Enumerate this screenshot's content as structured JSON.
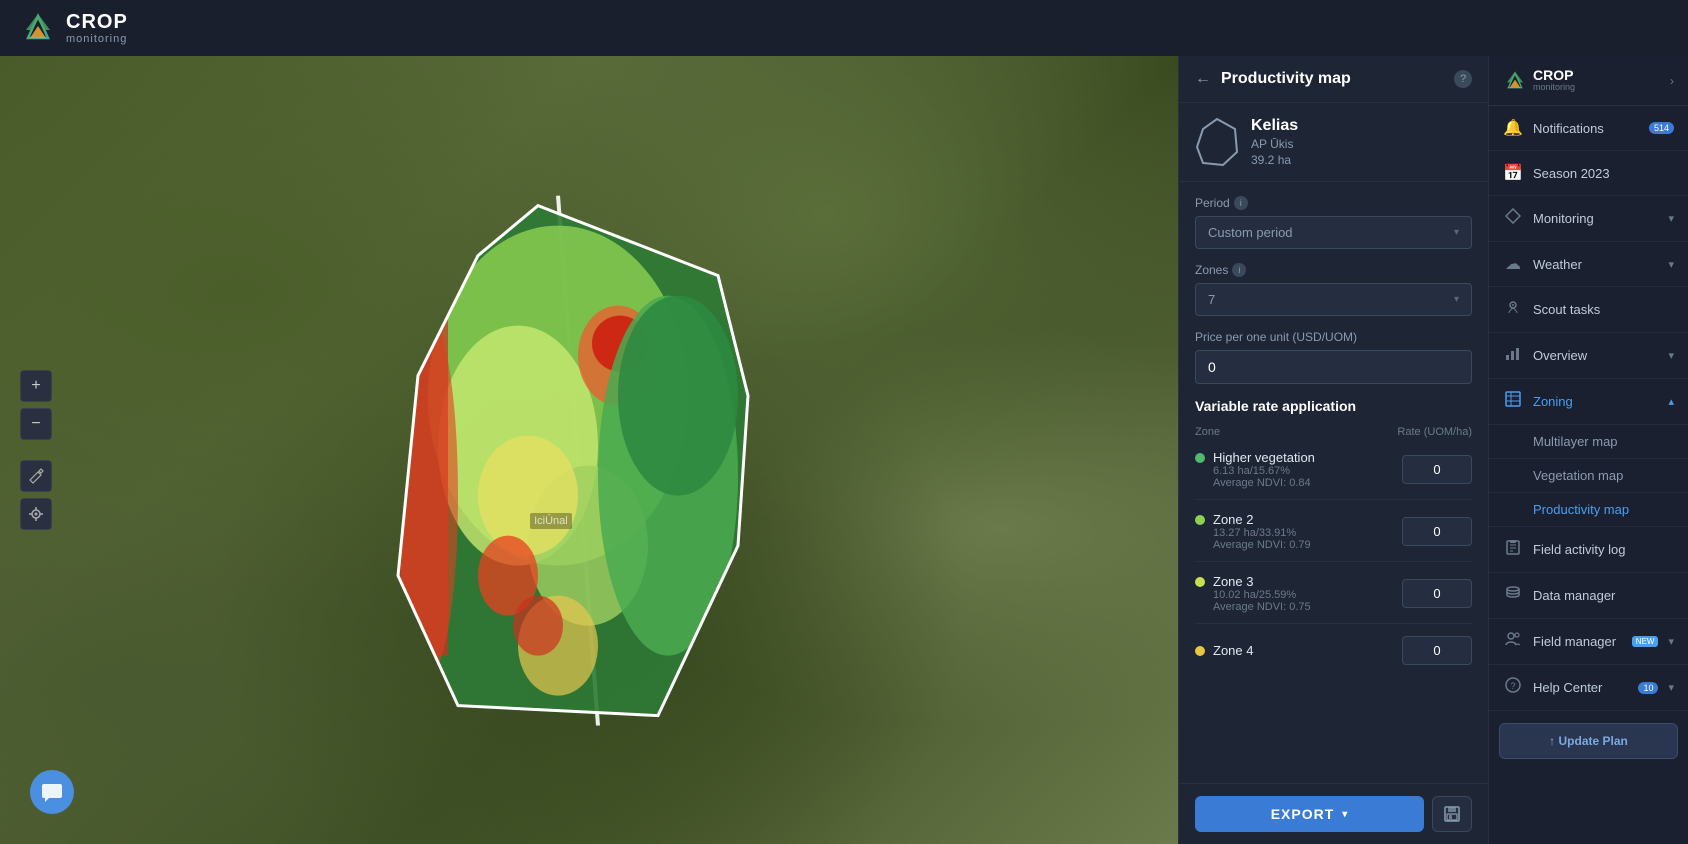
{
  "header": {
    "logo_crop": "CROP",
    "logo_monitoring": "monitoring"
  },
  "panel": {
    "back_label": "←",
    "title": "Productivity map",
    "help": "?",
    "field": {
      "name": "Kelias",
      "org": "AP Ūkis",
      "size": "39.2 ha"
    },
    "period_label": "Period",
    "period_value": "Custom period",
    "zones_label": "Zones",
    "zones_value": "7",
    "price_label": "Price per one unit (USD/UOM)",
    "price_value": "0",
    "vra_title": "Variable rate application",
    "zone_header_zone": "Zone",
    "zone_header_rate": "Rate (UOM/ha)",
    "zones": [
      {
        "name": "Higher vegetation",
        "color": "#4fba6f",
        "stats": "6.13 ha/15.67%",
        "ndvi": "Average NDVI: 0.84",
        "rate": "0"
      },
      {
        "name": "Zone 2",
        "color": "#90d050",
        "stats": "13.27 ha/33.91%",
        "ndvi": "Average NDVI: 0.79",
        "rate": "0"
      },
      {
        "name": "Zone 3",
        "color": "#c8e050",
        "stats": "10.02 ha/25.59%",
        "ndvi": "Average NDVI: 0.75",
        "rate": "0"
      },
      {
        "name": "Zone 4",
        "color": "#e8c840",
        "stats": "",
        "ndvi": "",
        "rate": "0"
      }
    ],
    "export_label": "EXPORT",
    "save_icon": "💾"
  },
  "map": {
    "label": "IciŪnal"
  },
  "right_sidebar": {
    "crop_label": "CROP",
    "monitoring_label": "monitoring",
    "items": [
      {
        "id": "notifications",
        "label": "Notifications",
        "icon": "🔔",
        "badge": "514",
        "has_chevron": false
      },
      {
        "id": "season",
        "label": "Season 2023",
        "icon": "📅",
        "badge": "",
        "has_chevron": false
      },
      {
        "id": "monitoring",
        "label": "Monitoring",
        "icon": "◇",
        "badge": "",
        "has_chevron": true
      },
      {
        "id": "weather",
        "label": "Weather",
        "icon": "☁",
        "badge": "",
        "has_chevron": true
      },
      {
        "id": "scout-tasks",
        "label": "Scout tasks",
        "icon": "◎",
        "badge": "",
        "has_chevron": false
      },
      {
        "id": "overview",
        "label": "Overview",
        "icon": "▦",
        "badge": "",
        "has_chevron": true
      },
      {
        "id": "zoning",
        "label": "Zoning",
        "icon": "▤",
        "badge": "",
        "has_chevron": true,
        "active": true
      }
    ],
    "sub_items": [
      {
        "id": "multilayer-map",
        "label": "Multilayer map",
        "active": false
      },
      {
        "id": "vegetation-map",
        "label": "Vegetation map",
        "active": false
      },
      {
        "id": "productivity-map",
        "label": "Productivity map",
        "active": true
      }
    ],
    "items_after": [
      {
        "id": "field-activity-log",
        "label": "Field activity log",
        "icon": "📋",
        "badge": "",
        "has_chevron": false
      },
      {
        "id": "data-manager",
        "label": "Data manager",
        "icon": "🗄",
        "badge": "",
        "has_chevron": false
      },
      {
        "id": "field-manager",
        "label": "Field manager",
        "icon": "👥",
        "badge": "",
        "has_chevron": true,
        "badge_new": "NEW"
      },
      {
        "id": "help-center",
        "label": "Help Center",
        "icon": "❓",
        "badge": "10",
        "has_chevron": true
      }
    ],
    "update_plan_label": "↑ Update Plan"
  }
}
